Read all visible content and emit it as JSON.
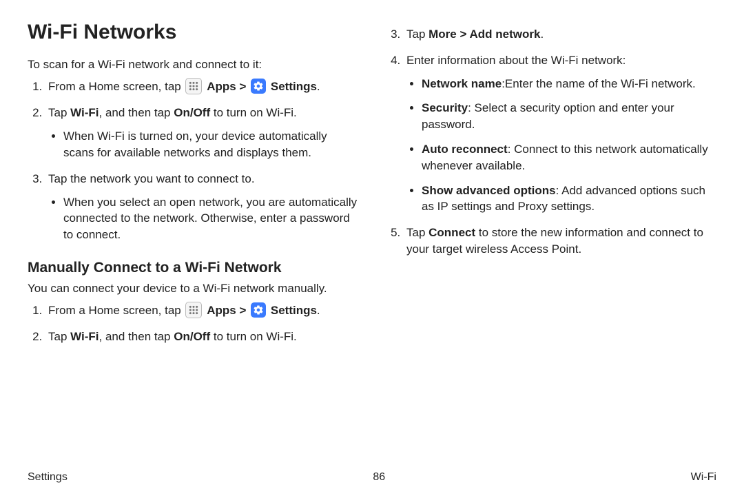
{
  "title": "Wi-Fi Networks",
  "intro": "To scan for a Wi-Fi network and connect to it:",
  "step1": {
    "prefix": "From a Home screen, tap",
    "apps": "Apps",
    "sep": ">",
    "settings": "Settings",
    "suffix": "."
  },
  "step2": {
    "p1": "Tap ",
    "b1": "Wi-Fi",
    "p2": ", and then tap ",
    "b2": "On/Off",
    "p3": " to turn on Wi-Fi."
  },
  "step2sub": "When Wi-Fi is turned on, your device automatically scans for available networks and displays them.",
  "step3": "Tap the network you want to connect to.",
  "step3sub": "When you select an open network, you are automatically connected to the network. Otherwise, enter a password to connect.",
  "manual": {
    "heading": "Manually Connect to a Wi-Fi Network",
    "intro": "You can connect your device to a Wi-Fi network manually.",
    "step1": {
      "prefix": "From a Home screen, tap",
      "apps": "Apps",
      "sep": ">",
      "settings": "Settings",
      "suffix": "."
    },
    "step2": {
      "p1": "Tap ",
      "b1": "Wi-Fi",
      "p2": ", and then tap ",
      "b2": "On/Off",
      "p3": " to turn on Wi-Fi."
    }
  },
  "right": {
    "step3": {
      "p1": "Tap ",
      "b1": "More > Add network",
      "p2": "."
    },
    "step4": "Enter information about the Wi-Fi network:",
    "bullets": {
      "a": {
        "b": "Network name",
        "t": ":Enter the name of the Wi-Fi network."
      },
      "b": {
        "b": "Security",
        "t": ": Select a security option and enter your password."
      },
      "c": {
        "b": "Auto reconnect",
        "t": ": Connect to this network automatically whenever available."
      },
      "d": {
        "b": "Show advanced options",
        "t": ": Add advanced options such as IP settings and Proxy settings."
      }
    },
    "step5": {
      "p1": "Tap ",
      "b1": "Connect",
      "p2": " to store the new information and connect to your target wireless Access Point."
    }
  },
  "footer": {
    "left": "Settings",
    "center": "86",
    "right": "Wi-Fi"
  }
}
